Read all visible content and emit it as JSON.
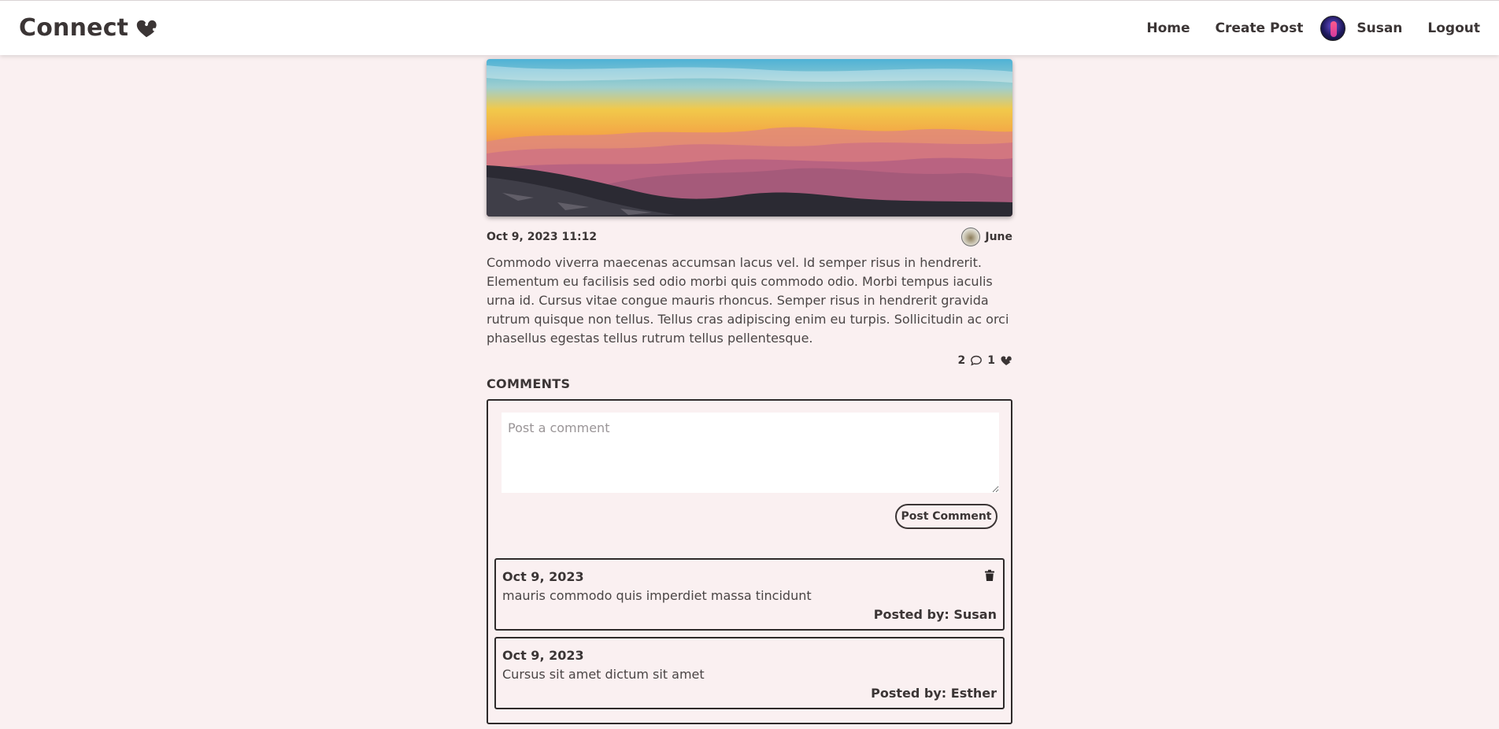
{
  "navbar": {
    "brand": "Connect",
    "brand_icon": "heart-puzzle-icon",
    "links": {
      "home": "Home",
      "create_post": "Create Post",
      "logout": "Logout"
    },
    "user": {
      "name": "Susan",
      "avatar": "user-avatar"
    }
  },
  "post": {
    "image": "mountain-sunset-image",
    "date": "Oct 9, 2023 11:12",
    "author": {
      "name": "June",
      "avatar": "author-avatar"
    },
    "body": "Commodo viverra maecenas accumsan lacus vel. Id semper risus in hendrerit. Elementum eu facilisis sed odio morbi quis commodo odio. Morbi tempus iaculis urna id. Cursus vitae congue mauris rhoncus. Semper risus in hendrerit gravida rutrum quisque non tellus. Tellus cras adipiscing enim eu turpis. Sollicitudin ac orci phasellus egestas tellus rutrum tellus pellentesque.",
    "comment_count": "2",
    "like_count": "1"
  },
  "comments": {
    "heading": "COMMENTS",
    "input_placeholder": "Post a comment",
    "input_value": "",
    "submit_label": "Post Comment",
    "items": [
      {
        "date": "Oct 9, 2023",
        "text": "mauris commodo quis imperdiet massa tincidunt",
        "author": "Posted by: Susan",
        "deletable": true
      },
      {
        "date": "Oct 9, 2023",
        "text": "Cursus sit amet dictum sit amet",
        "author": "Posted by: Esther",
        "deletable": false
      }
    ]
  },
  "colors": {
    "background": "#faf0f1",
    "navbar": "#ffffff",
    "text": "#3b3535"
  }
}
